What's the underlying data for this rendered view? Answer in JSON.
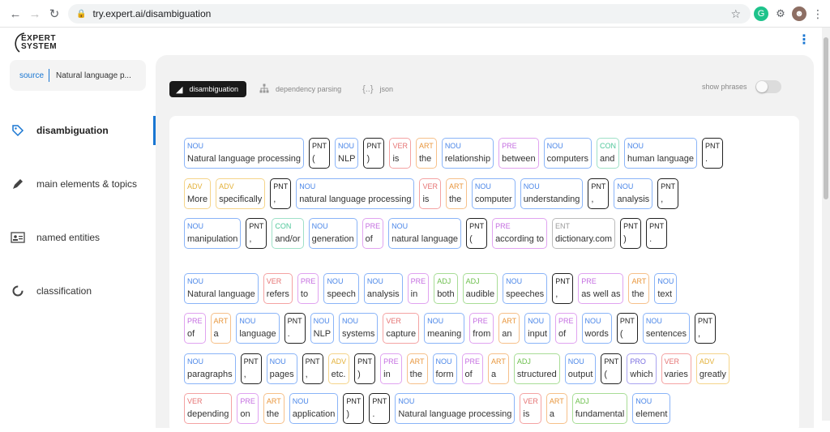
{
  "browser": {
    "url": "try.expert.ai/disambiguation"
  },
  "app": {
    "logo_line1": "EXPERT",
    "logo_line2": "SYSTEM"
  },
  "sidebar": {
    "source_label": "source",
    "source_value": "Natural language p...",
    "items": [
      {
        "label": "disambiguation",
        "icon": "tag-icon",
        "active": true
      },
      {
        "label": "main elements & topics",
        "icon": "pencil-icon",
        "active": false
      },
      {
        "label": "named entities",
        "icon": "id-card-icon",
        "active": false
      },
      {
        "label": "classification",
        "icon": "donut-icon",
        "active": false
      }
    ]
  },
  "tabs": [
    {
      "label": "disambiguation",
      "active": true
    },
    {
      "label": "dependency parsing",
      "active": false
    },
    {
      "label": "json",
      "active": false
    }
  ],
  "phrases_label": "show phrases",
  "colors": {
    "accent": "#1976d2",
    "NOU": "#4a86e8",
    "PNT": "#222222",
    "VER": "#e57373",
    "ART": "#e8963c",
    "PRE": "#c46ee0",
    "CON": "#4fc79a",
    "ADV": "#e3b13a",
    "ADJ": "#6cbf4c",
    "ENT": "#999999",
    "PRO": "#7b6fe0"
  },
  "rows": [
    [
      [
        "NOU",
        "Natural language processing"
      ],
      [
        "PNT",
        "("
      ],
      [
        "NOU",
        "NLP"
      ],
      [
        "PNT",
        ")"
      ],
      [
        "VER",
        "is"
      ],
      [
        "ART",
        "the"
      ],
      [
        "NOU",
        "relationship"
      ],
      [
        "PRE",
        "between"
      ],
      [
        "NOU",
        "computers"
      ],
      [
        "CON",
        "and"
      ],
      [
        "NOU",
        "human language"
      ],
      [
        "PNT",
        "."
      ]
    ],
    [
      [
        "ADV",
        "More"
      ],
      [
        "ADV",
        "specifically"
      ],
      [
        "PNT",
        ","
      ],
      [
        "NOU",
        "natural language processing"
      ],
      [
        "VER",
        "is"
      ],
      [
        "ART",
        "the"
      ],
      [
        "NOU",
        "computer"
      ],
      [
        "NOU",
        "understanding"
      ],
      [
        "PNT",
        ","
      ],
      [
        "NOU",
        "analysis"
      ],
      [
        "PNT",
        ","
      ]
    ],
    [
      [
        "NOU",
        "manipulation"
      ],
      [
        "PNT",
        ","
      ],
      [
        "CON",
        "and/or"
      ],
      [
        "NOU",
        "generation"
      ],
      [
        "PRE",
        "of"
      ],
      [
        "NOU",
        "natural language"
      ],
      [
        "PNT",
        "("
      ],
      [
        "PRE",
        "according to"
      ],
      [
        "ENT",
        "dictionary.com"
      ],
      [
        "PNT",
        ")"
      ],
      [
        "PNT",
        "."
      ]
    ],
    [
      [
        "NOU",
        "Natural language"
      ],
      [
        "VER",
        "refers"
      ],
      [
        "PRE",
        "to"
      ],
      [
        "NOU",
        "speech"
      ],
      [
        "NOU",
        "analysis"
      ],
      [
        "PRE",
        "in"
      ],
      [
        "ADJ",
        "both"
      ],
      [
        "ADJ",
        "audible"
      ],
      [
        "NOU",
        "speeches"
      ],
      [
        "PNT",
        ","
      ],
      [
        "PRE",
        "as well as"
      ],
      [
        "ART",
        "the"
      ],
      [
        "NOU",
        "text"
      ]
    ],
    [
      [
        "PRE",
        "of"
      ],
      [
        "ART",
        "a"
      ],
      [
        "NOU",
        "language"
      ],
      [
        "PNT",
        "."
      ],
      [
        "NOU",
        "NLP"
      ],
      [
        "NOU",
        "systems"
      ],
      [
        "VER",
        "capture"
      ],
      [
        "NOU",
        "meaning"
      ],
      [
        "PRE",
        "from"
      ],
      [
        "ART",
        "an"
      ],
      [
        "NOU",
        "input"
      ],
      [
        "PRE",
        "of"
      ],
      [
        "NOU",
        "words"
      ],
      [
        "PNT",
        "("
      ],
      [
        "NOU",
        "sentences"
      ],
      [
        "PNT",
        ","
      ]
    ],
    [
      [
        "NOU",
        "paragraphs"
      ],
      [
        "PNT",
        ","
      ],
      [
        "NOU",
        "pages"
      ],
      [
        "PNT",
        ","
      ],
      [
        "ADV",
        "etc."
      ],
      [
        "PNT",
        ")"
      ],
      [
        "PRE",
        "in"
      ],
      [
        "ART",
        "the"
      ],
      [
        "NOU",
        "form"
      ],
      [
        "PRE",
        "of"
      ],
      [
        "ART",
        "a"
      ],
      [
        "ADJ",
        "structured"
      ],
      [
        "NOU",
        "output"
      ],
      [
        "PNT",
        "("
      ],
      [
        "PRO",
        "which"
      ],
      [
        "VER",
        "varies"
      ],
      [
        "ADV",
        "greatly"
      ]
    ],
    [
      [
        "VER",
        "depending"
      ],
      [
        "PRE",
        "on"
      ],
      [
        "ART",
        "the"
      ],
      [
        "NOU",
        "application"
      ],
      [
        "PNT",
        ")"
      ],
      [
        "PNT",
        "."
      ],
      [
        "NOU",
        "Natural language processing"
      ],
      [
        "VER",
        "is"
      ],
      [
        "ART",
        "a"
      ],
      [
        "ADJ",
        "fundamental"
      ],
      [
        "NOU",
        "element"
      ]
    ]
  ]
}
